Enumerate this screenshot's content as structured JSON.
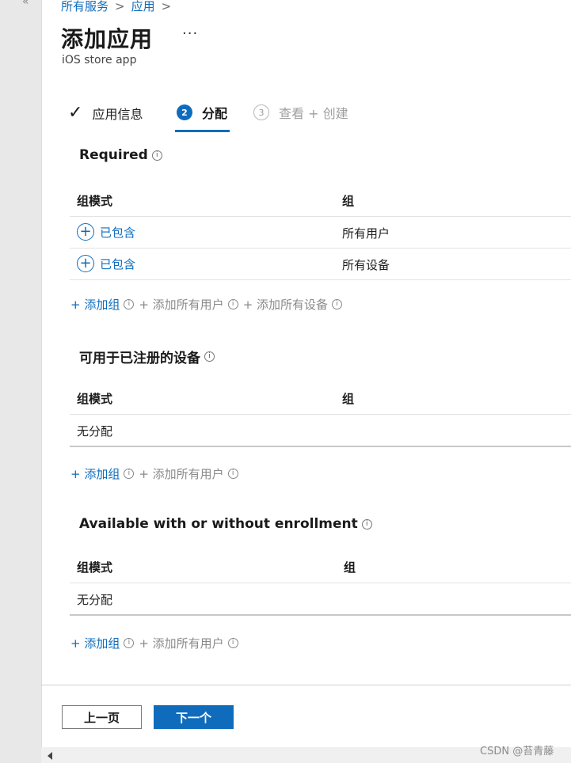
{
  "breadcrumb": {
    "item1": "所有服务",
    "item2": "应用",
    "sep": ">"
  },
  "header": {
    "title": "添加应用",
    "more": "···",
    "subtitle": "iOS store app"
  },
  "steps": [
    {
      "marker": "✓",
      "label": "应用信息",
      "state": "done"
    },
    {
      "marker": "2",
      "label": "分配",
      "state": "active"
    },
    {
      "marker": "3",
      "label": "查看 + 创建",
      "state": "inactive"
    }
  ],
  "sections": {
    "required": {
      "title": "Required",
      "col1": "组模式",
      "col2": "组",
      "rows": [
        {
          "mode": "已包含",
          "group": "所有用户"
        },
        {
          "mode": "已包含",
          "group": "所有设备"
        }
      ],
      "actions": {
        "add_group": "+ 添加组",
        "add_all_users": "+ 添加所有用户",
        "add_all_devices": "+ 添加所有设备"
      }
    },
    "enrolled": {
      "title": "可用于已注册的设备",
      "col1": "组模式",
      "col2": "组",
      "empty": "无分配",
      "actions": {
        "add_group": "+ 添加组",
        "add_all_users": "+ 添加所有用户"
      }
    },
    "available": {
      "title": "Available with or without enrollment",
      "col1": "组模式",
      "col2": "组",
      "empty": "无分配",
      "actions": {
        "add_group": "+ 添加组",
        "add_all_users": "+ 添加所有用户"
      }
    }
  },
  "footer": {
    "prev": "上一页",
    "next": "下一个"
  },
  "watermark": "CSDN @苔青藤",
  "colors": {
    "accent": "#0f6cbd"
  }
}
